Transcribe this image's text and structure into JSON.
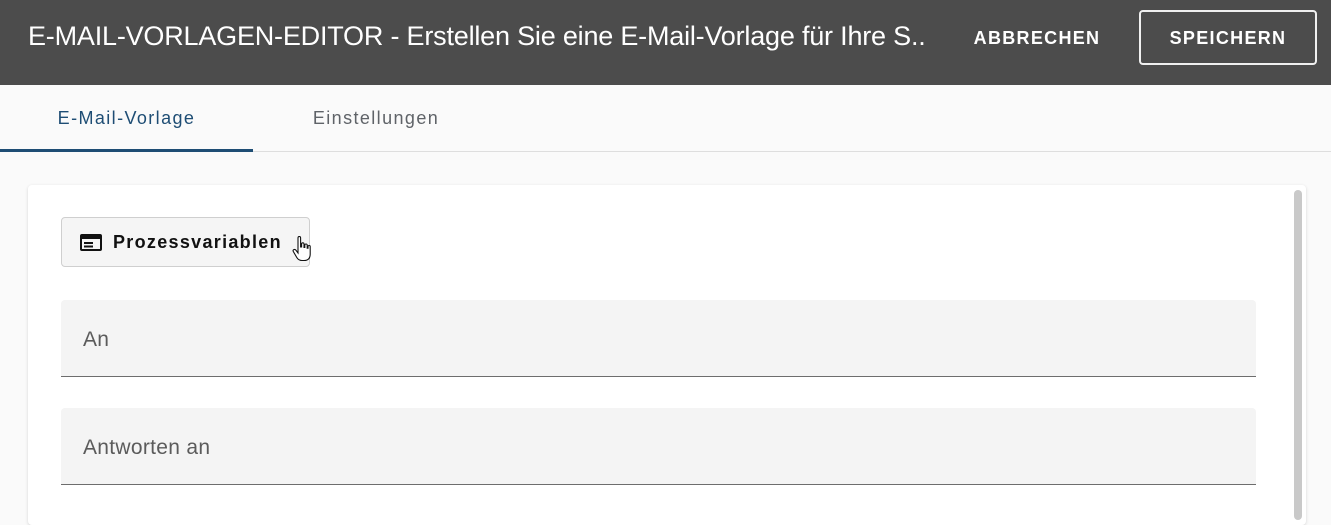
{
  "header": {
    "title": "E-MAIL-VORLAGEN-EDITOR - Erstellen Sie eine E-Mail-Vorlage für Ihre S...",
    "cancel_label": "ABBRECHEN",
    "save_label": "SPEICHERN"
  },
  "tabs": [
    {
      "label": "E-Mail-Vorlage",
      "active": true
    },
    {
      "label": "Einstellungen",
      "active": false
    }
  ],
  "content": {
    "process_variables_label": "Prozessvariablen",
    "process_variables_icon": "table-window-icon",
    "fields": [
      {
        "label": "An",
        "value": ""
      },
      {
        "label": "Antworten an",
        "value": ""
      }
    ]
  },
  "colors": {
    "header_bg": "#4c4c4c",
    "active_tab": "#1e4d74",
    "inactive_tab": "#5f6368"
  }
}
